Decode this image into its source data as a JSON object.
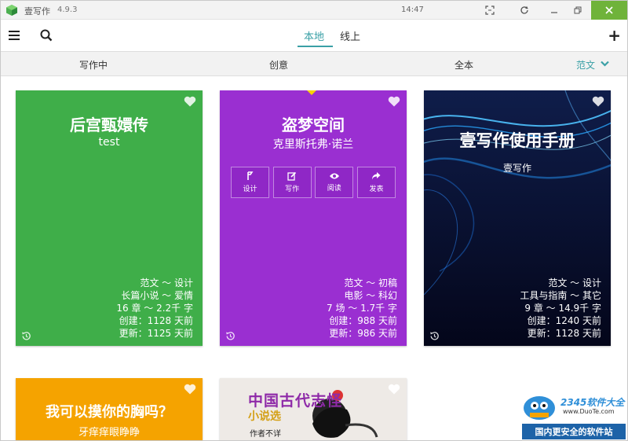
{
  "titlebar": {
    "app_name": "壹写作",
    "version": "4.9.3",
    "time": "14:47"
  },
  "toolbar": {
    "tabs": [
      {
        "label": "本地",
        "active": true
      },
      {
        "label": "线上",
        "active": false
      }
    ]
  },
  "filters": {
    "items": [
      "写作中",
      "创意",
      "全本"
    ],
    "selected": "范文"
  },
  "colors": {
    "accent": "#3aa0a6",
    "green_card": "#3fae49",
    "purple_card": "#9a2fd1",
    "navy_card": "#0a0e2c",
    "orange_card": "#f5a300"
  },
  "cards": [
    {
      "title": "后宫甄嬛传",
      "author": "test",
      "meta": [
        "范文 ～ 设计",
        "长篇小说 ～ 爱情",
        "16 章 ～ 2.2千 字",
        "创建：1128 天前",
        "更新：1125 天前"
      ]
    },
    {
      "title": "盗梦空间",
      "author": "克里斯托弗·诺兰",
      "actions": [
        "设计",
        "写作",
        "阅读",
        "发表"
      ],
      "meta": [
        "范文 ～ 初稿",
        "电影 ～ 科幻",
        "7 场 ～ 1.7千 字",
        "创建：988 天前",
        "更新：986 天前"
      ]
    },
    {
      "title": "壹写作使用手册",
      "author": "壹写作",
      "meta": [
        "范文 ～ 设计",
        "工具与指南 ～ 其它",
        "9 章 ～ 14.9千 字",
        "创建：1240 天前",
        "更新：1128 天前"
      ]
    },
    {
      "title": "我可以摸你的胸吗？",
      "author": "牙痒痒眼睁睁"
    },
    {
      "title": "中国古代志怪",
      "subtitle": "小说选",
      "author": "作者不详"
    }
  ],
  "watermark": {
    "logo": "2345软件大全",
    "url": "www.DuoTe.com",
    "slogan": "国内更安全的软件站"
  }
}
